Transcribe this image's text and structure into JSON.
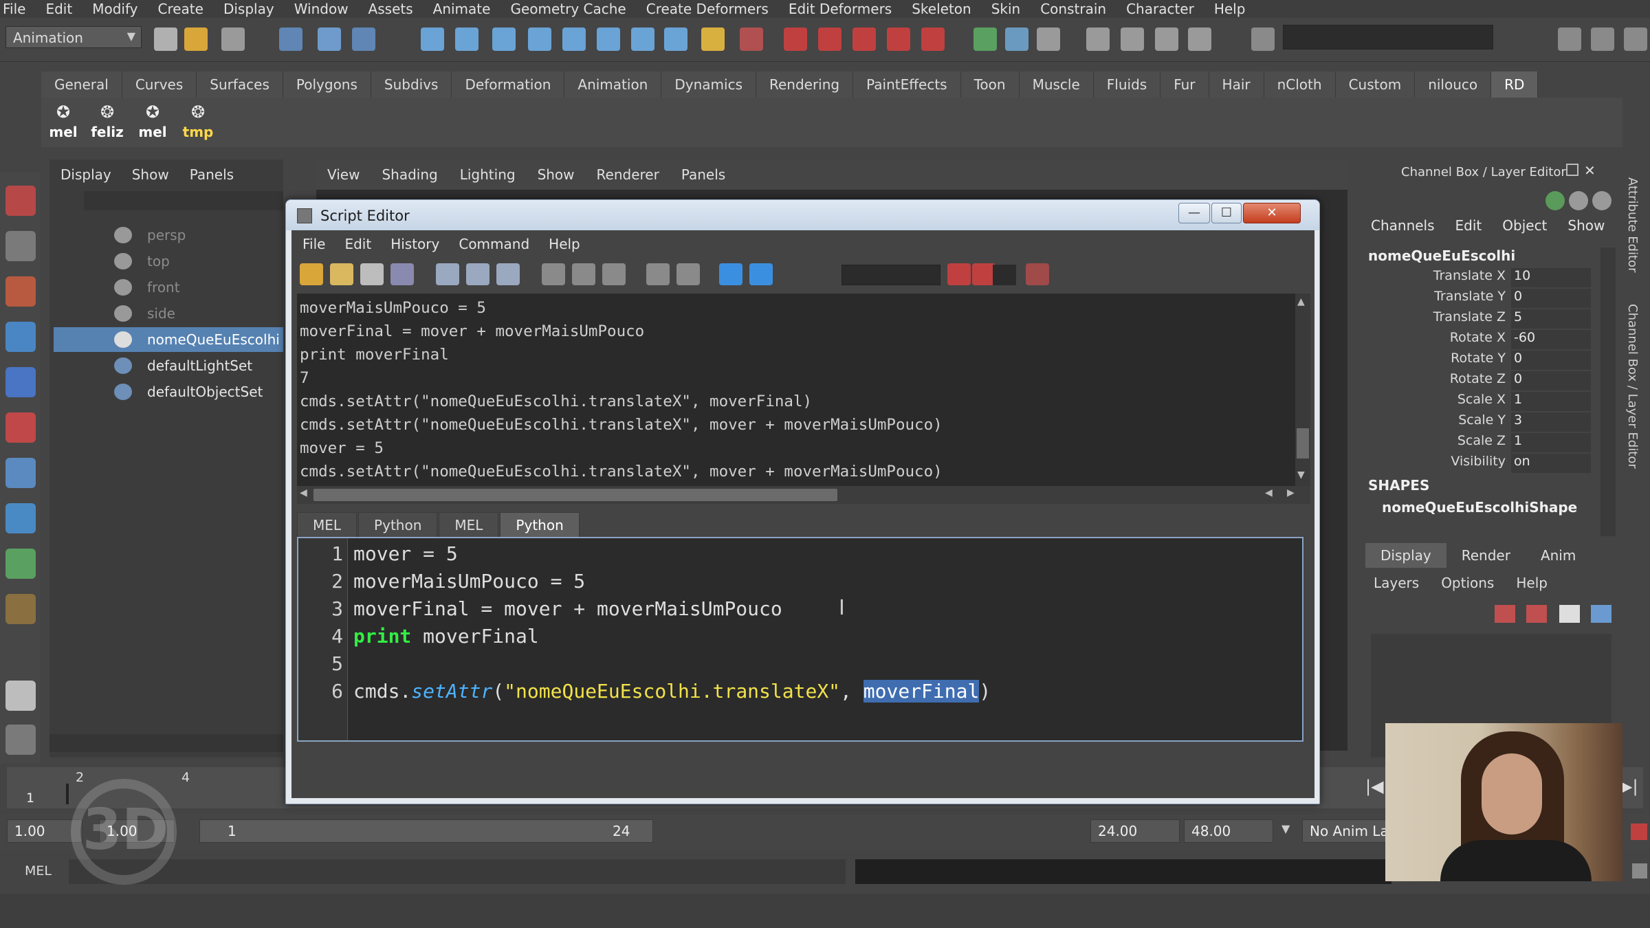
{
  "menubar": [
    "File",
    "Edit",
    "Modify",
    "Create",
    "Display",
    "Window",
    "Assets",
    "Animate",
    "Geometry Cache",
    "Create Deformers",
    "Edit Deformers",
    "Skeleton",
    "Skin",
    "Constrain",
    "Character",
    "Help"
  ],
  "mode_selector": "Animation",
  "shelf_tabs": [
    "General",
    "Curves",
    "Surfaces",
    "Polygons",
    "Subdivs",
    "Deformation",
    "Animation",
    "Dynamics",
    "Rendering",
    "PaintEffects",
    "Toon",
    "Muscle",
    "Fluids",
    "Fur",
    "Hair",
    "nCloth",
    "Custom",
    "nilouco",
    "RD"
  ],
  "shelf_buttons": [
    "mel",
    "feliz",
    "mel",
    "tmp"
  ],
  "outliner": {
    "menu": [
      "Display",
      "Show",
      "Panels"
    ],
    "items": [
      "persp",
      "top",
      "front",
      "side",
      "nomeQueEuEscolhi",
      "defaultLightSet",
      "defaultObjectSet"
    ]
  },
  "viewport_menu": [
    "View",
    "Shading",
    "Lighting",
    "Show",
    "Renderer",
    "Panels"
  ],
  "script_editor": {
    "title": "Script Editor",
    "menu": [
      "File",
      "Edit",
      "History",
      "Command",
      "Help"
    ],
    "history": [
      "moverMaisUmPouco = 5",
      "moverFinal = mover + moverMaisUmPouco",
      "print moverFinal",
      "7",
      "cmds.setAttr(\"nomeQueEuEscolhi.translateX\", moverFinal)",
      "cmds.setAttr(\"nomeQueEuEscolhi.translateX\", mover + moverMaisUmPouco)",
      "mover = 5",
      "cmds.setAttr(\"nomeQueEuEscolhi.translateX\", mover + moverMaisUmPouco)"
    ],
    "tabs": [
      "MEL",
      "Python",
      "MEL",
      "Python"
    ],
    "line_numbers": [
      "1",
      "2",
      "3",
      "4",
      "5",
      "6"
    ],
    "code": {
      "l1": "mover = 5",
      "l2": "moverMaisUmPouco = 5",
      "l3": "moverFinal = mover + moverMaisUmPouco",
      "l4_kw": "print",
      "l4_rest": " moverFinal",
      "l6_obj": "cmds.",
      "l6_fn": "setAttr",
      "l6_open": "(",
      "l6_str": "\"nomeQueEuEscolhi.translateX\"",
      "l6_sep": ", ",
      "l6_sel": "moverFinal",
      "l6_close": ")"
    }
  },
  "channel_box": {
    "title": "Channel Box / Layer Editor",
    "menu": [
      "Channels",
      "Edit",
      "Object",
      "Show"
    ],
    "object": "nomeQueEuEscolhi",
    "channels": [
      {
        "name": "Translate X",
        "value": "10"
      },
      {
        "name": "Translate Y",
        "value": "0"
      },
      {
        "name": "Translate Z",
        "value": "5"
      },
      {
        "name": "Rotate X",
        "value": "-60"
      },
      {
        "name": "Rotate Y",
        "value": "0"
      },
      {
        "name": "Rotate Z",
        "value": "0"
      },
      {
        "name": "Scale X",
        "value": "1"
      },
      {
        "name": "Scale Y",
        "value": "3"
      },
      {
        "name": "Scale Z",
        "value": "1"
      },
      {
        "name": "Visibility",
        "value": "on"
      }
    ],
    "shapes_label": "SHAPES",
    "shape": "nomeQueEuEscolhiShape",
    "layer_tabs": [
      "Display",
      "Render",
      "Anim"
    ],
    "layer_menu": [
      "Layers",
      "Options",
      "Help"
    ],
    "side_tabs": [
      "Attribute Editor",
      "Channel Box / Layer Editor"
    ]
  },
  "timeline": {
    "ticks": [
      "1",
      "2",
      "4"
    ],
    "start": "1.00",
    "start2": "1.00",
    "range_start": "1",
    "range_end": "24",
    "end": "24.00",
    "end2": "48.00",
    "anim_layer": "No Anim Lay"
  },
  "command_line": {
    "label": "MEL"
  },
  "watermark": "3D",
  "colors": {
    "accent": "#5682b2",
    "keyword": "#33ee44",
    "string": "#f2e24a",
    "function": "#4db3ff"
  }
}
